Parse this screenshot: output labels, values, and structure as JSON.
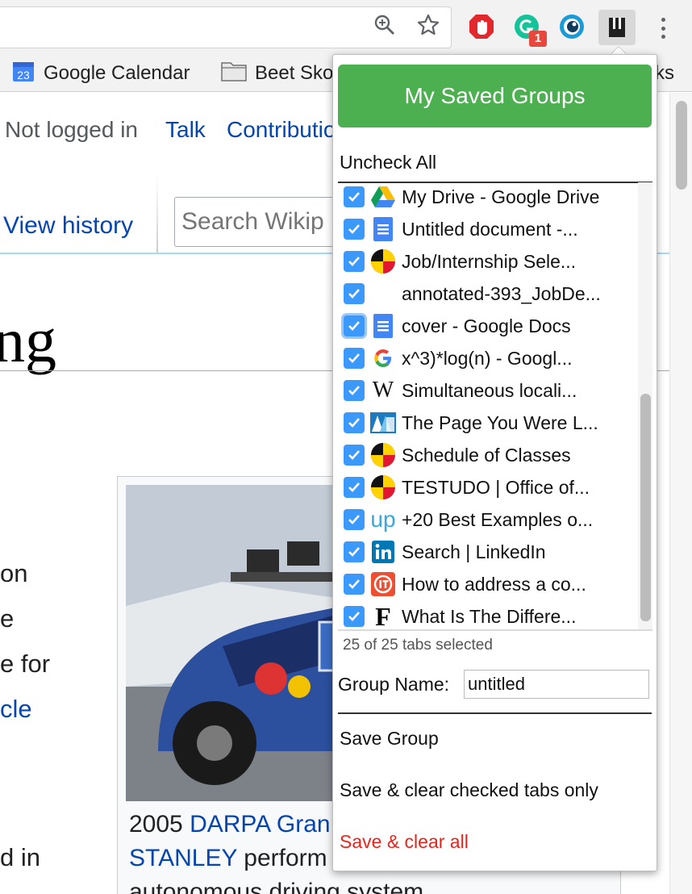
{
  "bookmarks": {
    "items": [
      {
        "label": "Google Calendar",
        "icon": "calendar-icon",
        "icon_text": "23"
      },
      {
        "label": "Beet Sko",
        "icon": "folder-icon"
      },
      {
        "label": "ks",
        "icon": "folder-icon"
      }
    ]
  },
  "wiki": {
    "personal": {
      "not_logged_in": "Not logged in",
      "talk": "Talk",
      "contributions": "Contributio"
    },
    "view_history": "View history",
    "search_placeholder": "Search Wikip",
    "heading_fragment": "ng",
    "body_fragments": [
      "on",
      "e",
      "e for",
      "cle",
      "d in"
    ],
    "caption": {
      "year": "2005",
      "link1": "DARPA Gran",
      "link2": "STANLEY",
      "text_after": " perform",
      "line3": "autonomous driving system"
    }
  },
  "popup": {
    "title": "My Saved Groups",
    "uncheck_all": "Uncheck All",
    "tabs": [
      {
        "label": "My Drive - Google Drive",
        "icon": "google-drive-icon",
        "checked": true
      },
      {
        "label": "Untitled document -...",
        "icon": "google-docs-icon",
        "checked": true
      },
      {
        "label": "Job/Internship Sele...",
        "icon": "umd-flag-icon",
        "checked": true
      },
      {
        "label": "annotated-393_JobDe...",
        "icon": "blank-icon",
        "checked": true
      },
      {
        "label": "cover - Google Docs",
        "icon": "google-docs-icon",
        "checked": true,
        "focused": true
      },
      {
        "label": "x^3)*log(n) - Googl...",
        "icon": "google-g-icon",
        "checked": true
      },
      {
        "label": "Simultaneous locali...",
        "icon": "wikipedia-icon",
        "checked": true
      },
      {
        "label": "The Page You Were L...",
        "icon": "aba-icon",
        "checked": true
      },
      {
        "label": "Schedule of Classes",
        "icon": "umd-flag-icon",
        "checked": true
      },
      {
        "label": "TESTUDO | Office of...",
        "icon": "umd-flag-icon",
        "checked": true
      },
      {
        "label": "+20 Best Examples o...",
        "icon": "upwork-icon",
        "checked": true
      },
      {
        "label": "Search | LinkedIn",
        "icon": "linkedin-icon",
        "checked": true
      },
      {
        "label": "How to address a co...",
        "icon": "it-icon",
        "checked": true
      },
      {
        "label": "What Is The Differe...",
        "icon": "forbes-icon",
        "checked": true
      }
    ],
    "selected_count": "25 of 25 tabs selected",
    "group_name_label": "Group Name:",
    "group_name_value": "untitled",
    "save_group": "Save Group",
    "save_clear_checked": "Save & clear checked tabs only",
    "save_clear_all": "Save & clear all"
  },
  "extensions": {
    "badge_count": "1"
  },
  "colors": {
    "accent_green": "#4caf50",
    "checkbox_blue": "#3b99fc",
    "danger_red": "#e8241b",
    "link_blue": "#0645ad"
  }
}
